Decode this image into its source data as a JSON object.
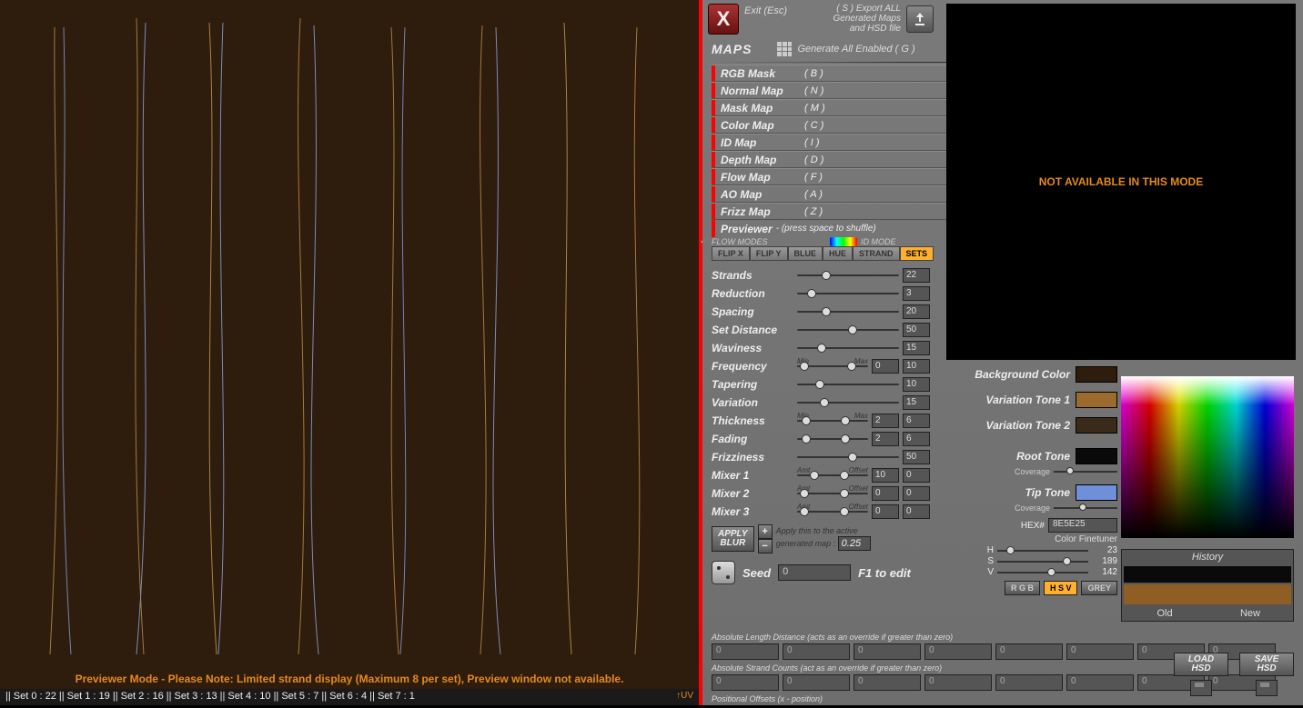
{
  "viewport": {
    "note": "Previewer Mode - Please Note: Limited strand display (Maximum 8 per set), Preview window not available.",
    "status": "|| Set 0 : 22  || Set 1 : 19  || Set 2 : 16  || Set 3 : 13  || Set 4 : 10  || Set 5 : 7   || Set 6 : 4   || Set 7 : 1",
    "uv": "↑UV"
  },
  "topbar": {
    "exit": "Exit (Esc)",
    "export_line1": "( S ) Export ALL",
    "export_line2": "Generated Maps",
    "export_line3": "and HSD file"
  },
  "preview": {
    "msg": "NOT AVAILABLE IN THIS MODE"
  },
  "maps": {
    "title": "MAPS",
    "gen_all": "Generate All Enabled ( G )",
    "items": [
      {
        "label": "RGB Mask",
        "key": "( B )"
      },
      {
        "label": "Normal Map",
        "key": "( N )"
      },
      {
        "label": "Mask Map",
        "key": "( M )"
      },
      {
        "label": "Color Map",
        "key": "( C )"
      },
      {
        "label": "ID Map",
        "key": "( I )"
      },
      {
        "label": "Depth Map",
        "key": "( D )"
      },
      {
        "label": "Flow Map",
        "key": "( F )"
      },
      {
        "label": "AO Map",
        "key": "( A )"
      },
      {
        "label": "Frizz Map",
        "key": "( Z )"
      }
    ],
    "previewer": "Previewer",
    "previewer_sub": "-  (press space to shuffle)"
  },
  "modes": {
    "flow_hdr": "FLOW MODES",
    "id_hdr": "ID MODE",
    "buttons": [
      "FLIP X",
      "FLIP Y",
      "BLUE",
      "HUE",
      "STRAND",
      "SETS"
    ],
    "active_index": 5
  },
  "sliders": [
    {
      "label": "Strands",
      "val": "22",
      "pos": 24
    },
    {
      "label": "Reduction",
      "val": "3",
      "pos": 10
    },
    {
      "label": "Spacing",
      "val": "20",
      "pos": 24
    },
    {
      "label": "Set Distance",
      "val": "50",
      "pos": 50
    },
    {
      "label": "Waviness",
      "val": "15",
      "pos": 20
    },
    {
      "label": "Frequency",
      "val": "0",
      "val2": "10",
      "pos": 4,
      "pos2": 70,
      "dual": true,
      "min": "Min",
      "max": "Max"
    },
    {
      "label": "Tapering",
      "val": "10",
      "pos": 18
    },
    {
      "label": "Variation",
      "val": "15",
      "pos": 22
    },
    {
      "label": "Thickness",
      "val": "2",
      "val2": "6",
      "pos": 6,
      "pos2": 62,
      "dual": true,
      "min": "Min",
      "max": "Max"
    },
    {
      "label": "Fading",
      "val": "2",
      "val2": "6",
      "pos": 6,
      "pos2": 62,
      "dual": true
    },
    {
      "label": "Frizziness",
      "val": "50",
      "pos": 50
    },
    {
      "label": "Mixer 1",
      "val": "10",
      "val2": "0",
      "pos": 18,
      "pos2": 60,
      "dual": true,
      "min": "Amt",
      "max": "Offset"
    },
    {
      "label": "Mixer 2",
      "val": "0",
      "val2": "0",
      "pos": 4,
      "pos2": 60,
      "dual": true,
      "min": "Amt",
      "max": "Offset"
    },
    {
      "label": "Mixer 3",
      "val": "0",
      "val2": "0",
      "pos": 4,
      "pos2": 60,
      "dual": true,
      "min": "Amt",
      "max": "Offset"
    }
  ],
  "apply": {
    "btn": "APPLY\nBLUR",
    "note1": "Apply this to the active",
    "note2": "generated map :",
    "val": "0.25"
  },
  "seed": {
    "label": "Seed",
    "val": "0",
    "f1": "F1 to edit"
  },
  "abs": {
    "len_lbl": "Absolute Length Distance (acts as an override if greater than zero)",
    "cnt_lbl": "Absolute Strand Counts (act as an override if greater than zero)",
    "pos_lbl": "Positional Offsets (x - position)",
    "vals": [
      "0",
      "0",
      "0",
      "0",
      "0",
      "0",
      "0",
      "0"
    ],
    "load": "LOAD\nHSD",
    "save": "SAVE\nHSD"
  },
  "colors": {
    "bg": {
      "label": "Background Color",
      "hex": "#2e1c0c"
    },
    "v1": {
      "label": "Variation Tone 1",
      "hex": "#9b6a2d",
      "active": true
    },
    "v2": {
      "label": "Variation Tone 2",
      "hex": "#3a2a1a"
    },
    "root": {
      "label": "Root Tone",
      "hex": "#0a0a0a",
      "cov": "Coverage",
      "covpos": 20
    },
    "tip": {
      "label": "Tip Tone",
      "hex": "#6f8fd8",
      "cov": "Coverage",
      "covpos": 40
    },
    "hex_lbl": "HEX#",
    "hex_val": "8E5E25",
    "ft": "Color Finetuner",
    "hsv": [
      {
        "l": "H",
        "v": "23",
        "pos": 10
      },
      {
        "l": "S",
        "v": "189",
        "pos": 72
      },
      {
        "l": "V",
        "v": "142",
        "pos": 55
      }
    ],
    "mode_btns": [
      "R G B",
      "H S V",
      "GREY"
    ],
    "mode_active": 1
  },
  "history": {
    "title": "History",
    "old": "Old",
    "new": "New",
    "cur": "#8E5E25"
  }
}
